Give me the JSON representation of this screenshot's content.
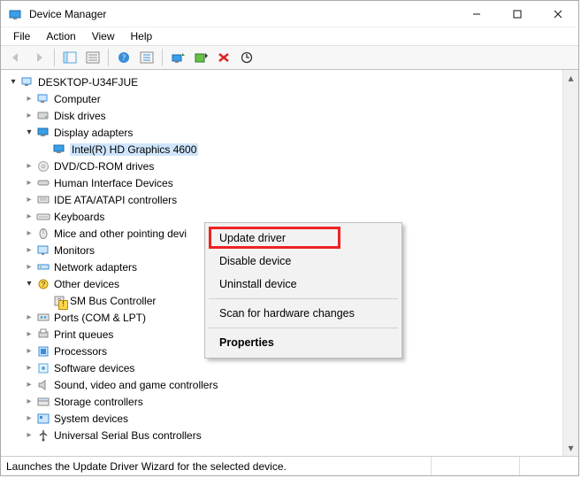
{
  "window": {
    "title": "Device Manager"
  },
  "menubar": [
    "File",
    "Action",
    "View",
    "Help"
  ],
  "statusbar": "Launches the Update Driver Wizard for the selected device.",
  "root_node": "DESKTOP-U34FJUE",
  "tree": [
    {
      "label": "Computer",
      "icon": "computer",
      "expanded": false
    },
    {
      "label": "Disk drives",
      "icon": "disk",
      "expanded": false
    },
    {
      "label": "Display adapters",
      "icon": "display",
      "expanded": true,
      "children": [
        {
          "label": "Intel(R) HD Graphics 4600",
          "icon": "display",
          "selected": true
        }
      ]
    },
    {
      "label": "DVD/CD-ROM drives",
      "icon": "dvd",
      "expanded": false
    },
    {
      "label": "Human Interface Devices",
      "icon": "hid",
      "expanded": false
    },
    {
      "label": "IDE ATA/ATAPI controllers",
      "icon": "ide",
      "expanded": false
    },
    {
      "label": "Keyboards",
      "icon": "keyboard",
      "expanded": false
    },
    {
      "label": "Mice and other pointing devi",
      "icon": "mouse",
      "expanded": false
    },
    {
      "label": "Monitors",
      "icon": "monitor",
      "expanded": false
    },
    {
      "label": "Network adapters",
      "icon": "network",
      "expanded": false
    },
    {
      "label": "Other devices",
      "icon": "other",
      "expanded": true,
      "children": [
        {
          "label": "SM Bus Controller",
          "icon": "unknown",
          "warning": true
        }
      ]
    },
    {
      "label": "Ports (COM & LPT)",
      "icon": "ports",
      "expanded": false
    },
    {
      "label": "Print queues",
      "icon": "printer",
      "expanded": false
    },
    {
      "label": "Processors",
      "icon": "cpu",
      "expanded": false
    },
    {
      "label": "Software devices",
      "icon": "software",
      "expanded": false
    },
    {
      "label": "Sound, video and game controllers",
      "icon": "sound",
      "expanded": false
    },
    {
      "label": "Storage controllers",
      "icon": "storage",
      "expanded": false
    },
    {
      "label": "System devices",
      "icon": "system",
      "expanded": false
    },
    {
      "label": "Universal Serial Bus controllers",
      "icon": "usb",
      "expanded": false
    }
  ],
  "context_menu": {
    "items": [
      {
        "label": "Update driver",
        "highlighted": true
      },
      {
        "label": "Disable device"
      },
      {
        "label": "Uninstall device"
      },
      {
        "sep": true
      },
      {
        "label": "Scan for hardware changes"
      },
      {
        "sep": true
      },
      {
        "label": "Properties",
        "bold": true
      }
    ]
  }
}
